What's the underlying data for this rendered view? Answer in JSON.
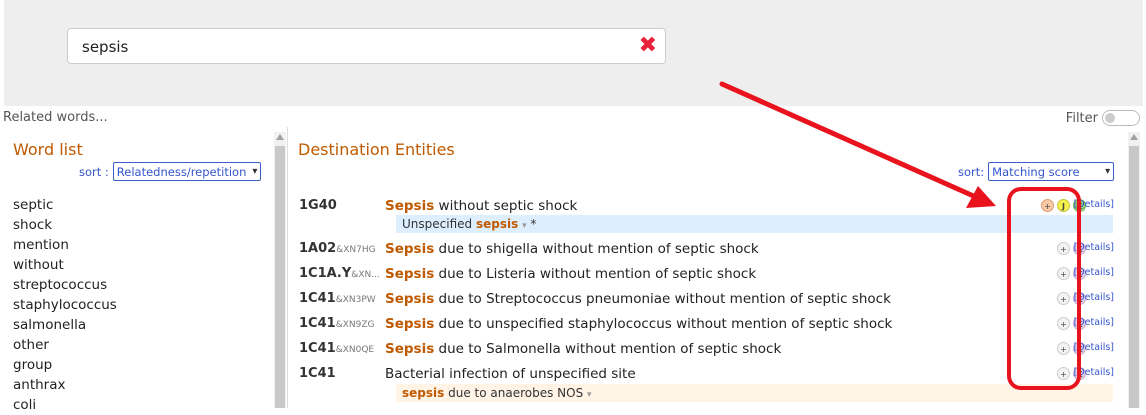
{
  "search": {
    "value": "sepsis",
    "clear_icon": "✖"
  },
  "related_label": "Related words...",
  "filter_label": "Filter",
  "word_list": {
    "title": "Word list",
    "sort_label": "sort :",
    "sort_value": "Relatedness/repetition",
    "words": [
      "septic",
      "shock",
      "mention",
      "without",
      "streptococcus",
      "staphylococcus",
      "salmonella",
      "other",
      "group",
      "anthrax",
      "coli"
    ]
  },
  "destination": {
    "title": "Destination Entities",
    "sort_label": "sort:",
    "sort_value": "Matching score",
    "details_label": "[Details]",
    "rows": [
      {
        "code": "1G40",
        "code_suffix": "",
        "highlight": "Sepsis",
        "rest": " without septic shock",
        "sub": {
          "before": "Unspecified ",
          "highlight": "sepsis",
          "after": "  *",
          "style": "blue"
        }
      },
      {
        "code": "1A02",
        "code_suffix": "&XN7HG",
        "highlight": "Sepsis",
        "rest": " due to shigella without mention of septic shock"
      },
      {
        "code": "1C1A.Y",
        "code_suffix": "&XN...",
        "highlight": "Sepsis",
        "rest": " due to Listeria without mention of septic shock"
      },
      {
        "code": "1C41",
        "code_suffix": "&XN3PW",
        "highlight": "Sepsis",
        "rest": " due to Streptococcus pneumoniae without mention of septic shock"
      },
      {
        "code": "1C41",
        "code_suffix": "&XN9ZG",
        "highlight": "Sepsis",
        "rest": " due to unspecified staphylococcus without mention of septic shock"
      },
      {
        "code": "1C41",
        "code_suffix": "&XN0QE",
        "highlight": "Sepsis",
        "rest": " due to Salmonella without mention of septic shock"
      },
      {
        "code": "1C41",
        "code_suffix": "",
        "highlight": "",
        "rest": "Bacterial infection of unspecified site",
        "sub": {
          "before": "",
          "highlight": "sepsis",
          "after": " due to anaerobes NOS",
          "style": "beige"
        }
      }
    ]
  },
  "annotation": {
    "color": "#e8131d"
  },
  "icons": {
    "plus": "+",
    "k": "K",
    "j": "J",
    "eq": "☰",
    "dropdown": "▾",
    "sub_dropdown": "▾"
  }
}
